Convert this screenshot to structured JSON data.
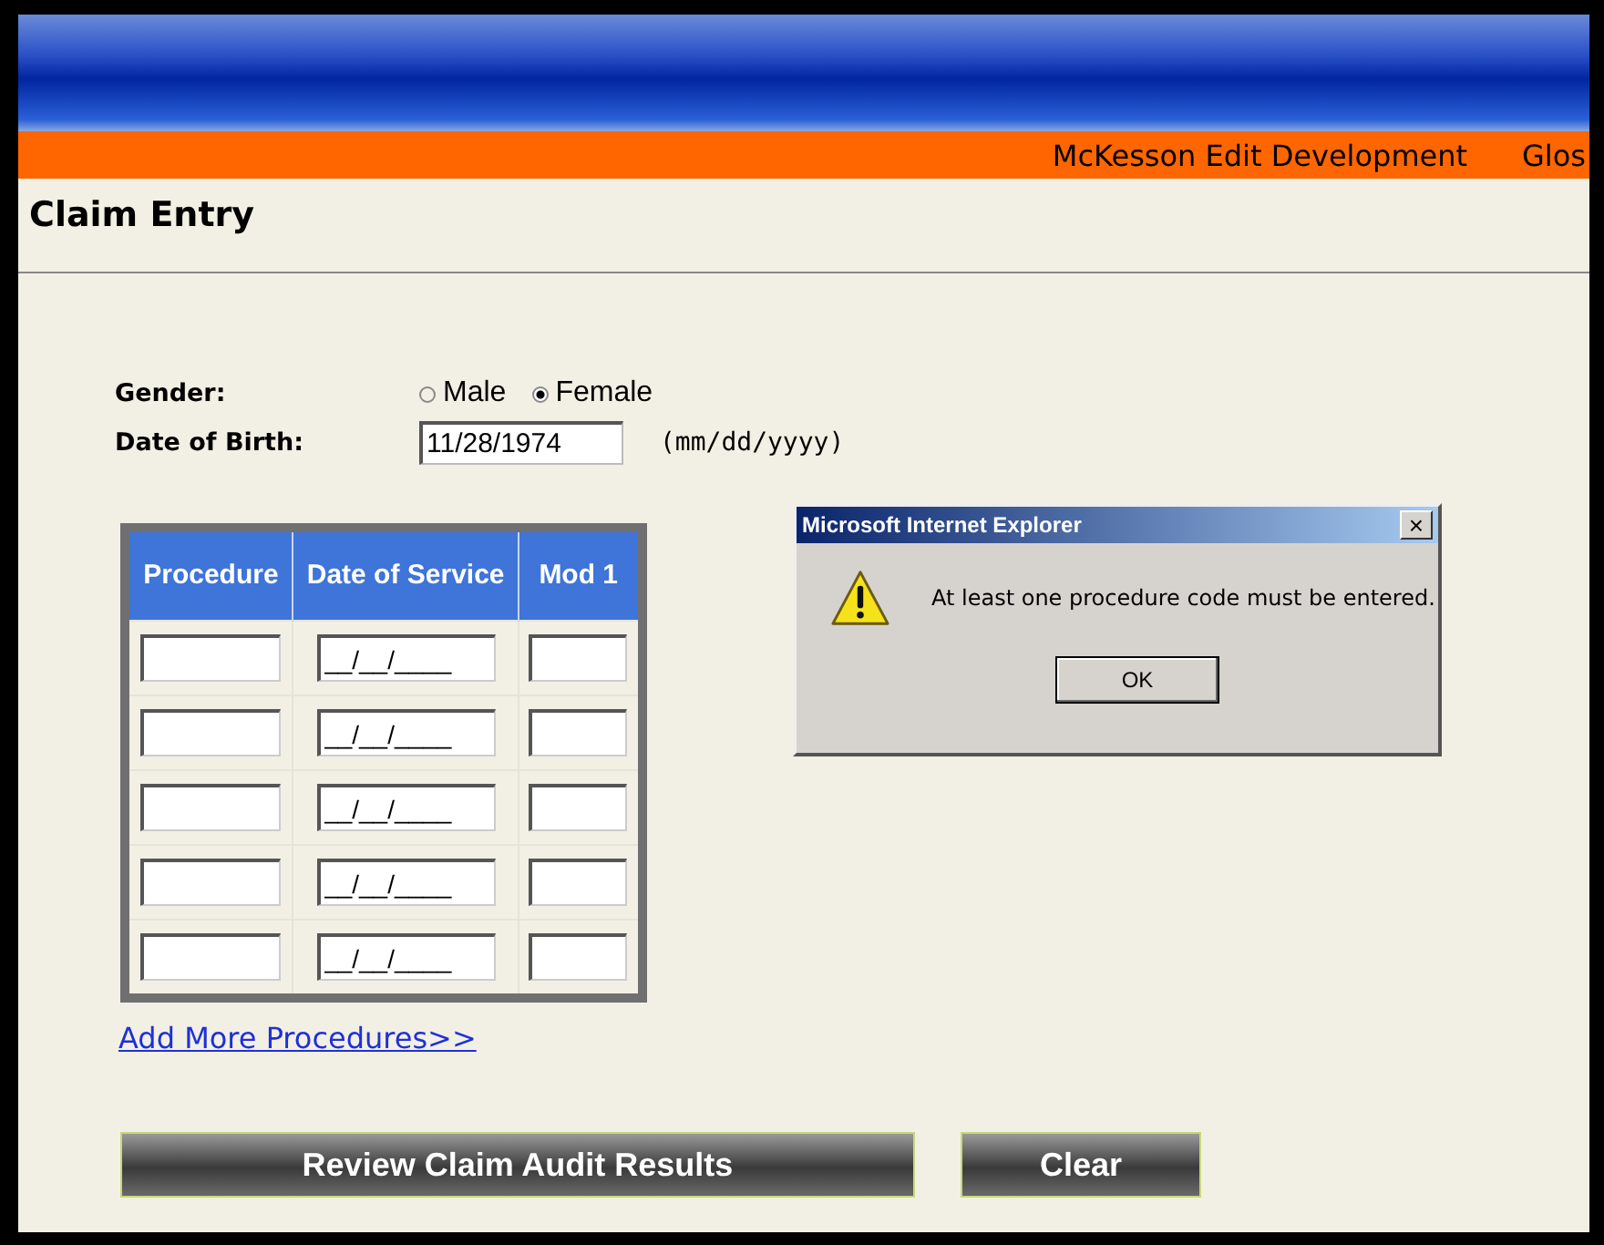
{
  "header": {
    "links": [
      "McKesson Edit Development",
      "Glos"
    ]
  },
  "page": {
    "title": "Claim Entry"
  },
  "form": {
    "gender": {
      "label": "Gender:",
      "options": [
        {
          "label": "Male",
          "selected": false
        },
        {
          "label": "Female",
          "selected": true
        }
      ]
    },
    "dob": {
      "label": "Date of Birth:",
      "value": "11/28/1974",
      "hint": "(mm/dd/yyyy)"
    }
  },
  "table": {
    "columns": [
      "Procedure",
      "Date of Service",
      "Mod 1"
    ],
    "rows": [
      {
        "procedure": "",
        "date": "__/__/____",
        "mod": ""
      },
      {
        "procedure": "",
        "date": "__/__/____",
        "mod": ""
      },
      {
        "procedure": "",
        "date": "__/__/____",
        "mod": ""
      },
      {
        "procedure": "",
        "date": "__/__/____",
        "mod": ""
      },
      {
        "procedure": "",
        "date": "__/__/____",
        "mod": ""
      }
    ]
  },
  "add_link": "Add More Procedures>>",
  "buttons": [
    "Review Claim Audit Results",
    "Clear"
  ],
  "dialog": {
    "title": "Microsoft Internet Explorer",
    "close": "×",
    "message": "At least one procedure code must be entered.",
    "button": "OK"
  }
}
